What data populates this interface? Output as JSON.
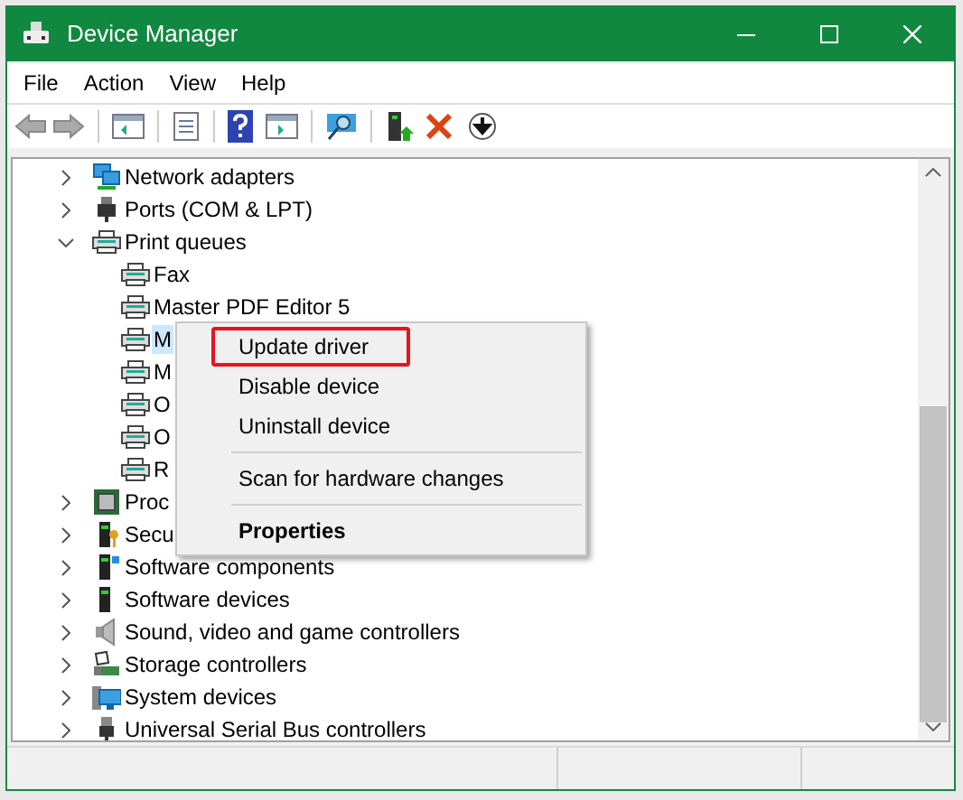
{
  "window": {
    "title": "Device Manager"
  },
  "menu_bar": [
    "File",
    "Action",
    "View",
    "Help"
  ],
  "tree": [
    {
      "label": "Network adapters",
      "expanded": false,
      "selected": false
    },
    {
      "label": "Ports (COM & LPT)",
      "expanded": false,
      "selected": false
    },
    {
      "label": "Print queues",
      "expanded": true,
      "selected": false,
      "children": [
        {
          "label": "Fax",
          "selected": false
        },
        {
          "label": "Master PDF Editor 5",
          "selected": false
        },
        {
          "label": "M",
          "selected": true
        },
        {
          "label": "M",
          "selected": false
        },
        {
          "label": "O",
          "selected": false
        },
        {
          "label": "O",
          "selected": false
        },
        {
          "label": "R",
          "selected": false
        }
      ]
    },
    {
      "label": "Proc",
      "expanded": false,
      "selected": false
    },
    {
      "label": "Secu",
      "expanded": false,
      "selected": false
    },
    {
      "label": "Software components",
      "expanded": false,
      "selected": false
    },
    {
      "label": "Software devices",
      "expanded": false,
      "selected": false
    },
    {
      "label": "Sound, video and game controllers",
      "expanded": false,
      "selected": false
    },
    {
      "label": "Storage controllers",
      "expanded": false,
      "selected": false
    },
    {
      "label": "System devices",
      "expanded": false,
      "selected": false
    },
    {
      "label": "Universal Serial Bus controllers",
      "expanded": false,
      "selected": false
    }
  ],
  "context_menu": [
    {
      "kind": "item",
      "label": "Update driver",
      "highlighted": true
    },
    {
      "kind": "item",
      "label": "Disable device",
      "highlighted": false
    },
    {
      "kind": "item",
      "label": "Uninstall device",
      "highlighted": false
    },
    {
      "kind": "separator"
    },
    {
      "kind": "item",
      "label": "Scan for hardware changes",
      "highlighted": false
    },
    {
      "kind": "separator"
    },
    {
      "kind": "default",
      "label": "Properties",
      "highlighted": false
    }
  ]
}
